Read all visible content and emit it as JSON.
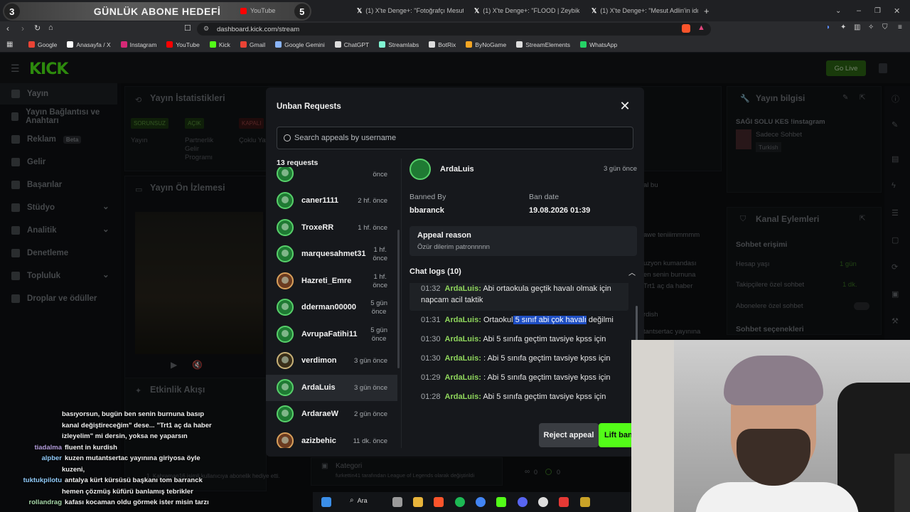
{
  "browser": {
    "goal_banner": {
      "left_num": "3",
      "text": "GÜNLÜK ABONE HEDEFİ",
      "right_num": "5"
    },
    "tabs": [
      {
        "label": "YouTube"
      },
      {
        "label": "(1) X'te Denge+: \"Fotoğrafçı Mesut A"
      },
      {
        "label": "(1) X'te Denge+: \"FLOOD | Zeybik ve"
      },
      {
        "label": "(1) X'te Denge+: \"Mesut Adlin'in iddi"
      }
    ],
    "new_tab": "+",
    "url": "dashboard.kick.com/stream",
    "bookmarks": [
      {
        "label": "Google",
        "color": "#ea4335"
      },
      {
        "label": "Anasayfa / X",
        "color": "#ffffff"
      },
      {
        "label": "Instagram",
        "color": "#d62976"
      },
      {
        "label": "YouTube",
        "color": "#ff0000"
      },
      {
        "label": "Kick",
        "color": "#53fc18"
      },
      {
        "label": "Gmail",
        "color": "#ea4335"
      },
      {
        "label": "Google Gemini",
        "color": "#8ab4f8"
      },
      {
        "label": "ChatGPT",
        "color": "#dddddd"
      },
      {
        "label": "Streamlabs",
        "color": "#80f5d2"
      },
      {
        "label": "BotRix",
        "color": "#dddddd"
      },
      {
        "label": "ByNoGame",
        "color": "#f5a623"
      },
      {
        "label": "StreamElements",
        "color": "#dddddd"
      },
      {
        "label": "WhatsApp",
        "color": "#25d366"
      }
    ]
  },
  "app": {
    "logo": "KICK",
    "go_live": "Go Live",
    "sidebar": [
      {
        "label": "Yayın",
        "active": true
      },
      {
        "label": "Yayın Bağlantısı ve Anahtarı"
      },
      {
        "label": "Reklam",
        "badge": "Beta"
      },
      {
        "label": "Gelir"
      },
      {
        "label": "Başarılar"
      },
      {
        "label": "Stüdyo",
        "chevron": true
      },
      {
        "label": "Analitik",
        "chevron": true
      },
      {
        "label": "Denetleme"
      },
      {
        "label": "Topluluk",
        "chevron": true
      },
      {
        "label": "Droplar ve ödüller"
      }
    ],
    "bg_panels": {
      "stats_title": "Yayın İstatistikleri",
      "stats_badges": [
        "SORUNSUZ",
        "AÇIK",
        "KAPALI"
      ],
      "stats_labels": [
        "Yayın",
        "Partnerlik Gelir Programı",
        "Çoklu Yay"
      ],
      "preview_title": "Yayın Ön İzlemesi",
      "activity_title": "Etkinlik Akışı",
      "category_label": "Kategori",
      "category_text": "furkettin41 tarafından League of Legends olarak değiştirildi",
      "activity_text": "1. Kahraman16 isimli kullanıcıya abonelik hediye etti.",
      "viewer_counts": [
        "0",
        "0"
      ],
      "info_title": "Yayın bilgisi",
      "stream_title": "SAĞI SOLU KES !instagram",
      "stream_category": "Sadece Sohbet",
      "stream_lang": "Turkish",
      "channel_actions_title": "Kanal Eylemleri",
      "chat_access": "Sohbet erişimi",
      "account_age": "Hesap yaşı",
      "account_age_value": "1 gün",
      "followers_only": "Takipçilere özel sohbet",
      "followers_only_value": "1 dk.",
      "subs_only": "Abonelere özel sohbet",
      "chat_options": "Sohbet seçenekleri",
      "chat_bits": [
        "al bu",
        "awe teniiimmmmm",
        "uzyon kumandası",
        "en senin burnuna",
        "Trt1 aç da haber",
        "rdish",
        "tantsertac yayınına"
      ]
    }
  },
  "modal": {
    "title": "Unban Requests",
    "search_placeholder": "Search appeals by username",
    "request_count": "13 requests",
    "partial_top_time": "önce",
    "requests": [
      {
        "name": "caner1111",
        "time": "2 hf. önce",
        "avatar": "green"
      },
      {
        "name": "TroxeRR",
        "time": "1 hf. önce",
        "avatar": "green"
      },
      {
        "name": "marquesahmet31",
        "time": "1 hf.\nönce",
        "avatar": "green"
      },
      {
        "name": "Hazreti_Emre",
        "time": "1 hf.\nönce",
        "avatar": "brown"
      },
      {
        "name": "dderman00000",
        "time": "5 gün\nönce",
        "avatar": "green"
      },
      {
        "name": "AvrupaFatihi11",
        "time": "5 gün\nönce",
        "avatar": "green"
      },
      {
        "name": "verdimon",
        "time": "3 gün önce",
        "avatar": "dark"
      },
      {
        "name": "ArdaLuis",
        "time": "3 gün önce",
        "avatar": "green",
        "selected": true
      },
      {
        "name": "ArdaraeW",
        "time": "2 gün önce",
        "avatar": "green"
      },
      {
        "name": "azizbehic",
        "time": "11 dk. önce",
        "avatar": "brown"
      }
    ],
    "detail": {
      "username": "ArdaLuis",
      "time": "3 gün önce",
      "banned_by_label": "Banned By",
      "banned_by": "bbaranck",
      "ban_date_label": "Ban date",
      "ban_date": "19.08.2026 01:39",
      "appeal_reason_label": "Appeal reason",
      "appeal_reason": "Özür dilerim patronnnnn",
      "chat_logs_title": "Chat logs (10)",
      "chat_logs": [
        {
          "time": "01:32",
          "user": "ArdaLuis:",
          "text": "Abi ortaokula geçtik havalı olmak için napcam acil taktik"
        },
        {
          "time": "01:31",
          "user": "ArdaLuis:",
          "pre": "Ortaokul",
          "hl": " 5 sınıf abi çok havalı",
          "post": " değilmi"
        },
        {
          "time": "01:30",
          "user": "ArdaLuis:",
          "text": "Abi 5 sınıfa geçtim tavsiye kpss için"
        },
        {
          "time": "01:30",
          "user": "ArdaLuis:",
          "text": ": Abi 5 sınıfa geçtim tavsiye kpss için"
        },
        {
          "time": "01:29",
          "user": "ArdaLuis:",
          "text": ": Abi 5 sınıfa geçtim tavsiye kpss için"
        },
        {
          "time": "01:28",
          "user": "ArdaLuis:",
          "text": "Abi 5 sınıfa geçtim tavsiye kpss için"
        }
      ]
    },
    "reject_label": "Reject appeal",
    "lift_label": "Lift ban"
  },
  "chat_overlay": [
    {
      "user": "",
      "text": "basıyorsun, bugün ben senin burnuna basıp"
    },
    {
      "user": "",
      "text": "kanal değiştireceğim\" dese... \"Trt1 aç da haber"
    },
    {
      "user": "",
      "text": "izleyelim\" mi dersin, yoksa ne yaparsın"
    },
    {
      "user": "tiadalma",
      "user_color": "#b39ddb",
      "text": "fluent in kurdish"
    },
    {
      "user": "alpber",
      "user_color": "#90caf9",
      "text": "kuzen mutantsertac yayınına giriyosa öyle"
    },
    {
      "user": "",
      "text": "kuzeni,"
    },
    {
      "user": "tuktukpilotu",
      "user_color": "#90caf9",
      "text": "antalya kürt kürsüsü başkanı tom barranck"
    },
    {
      "user": "",
      "text": "hemen çözmüş küfürü banlamış tebrikler"
    },
    {
      "user": "rollandrag",
      "user_color": "#a5d6a7",
      "text": "kafası kocaman oldu görmek ister misin tarzı"
    }
  ],
  "taskbar": {
    "search": "Ara"
  },
  "colors": {
    "kick_green": "#53fc18",
    "highlight": "#1f4fc4",
    "username": "#8fd65c"
  }
}
